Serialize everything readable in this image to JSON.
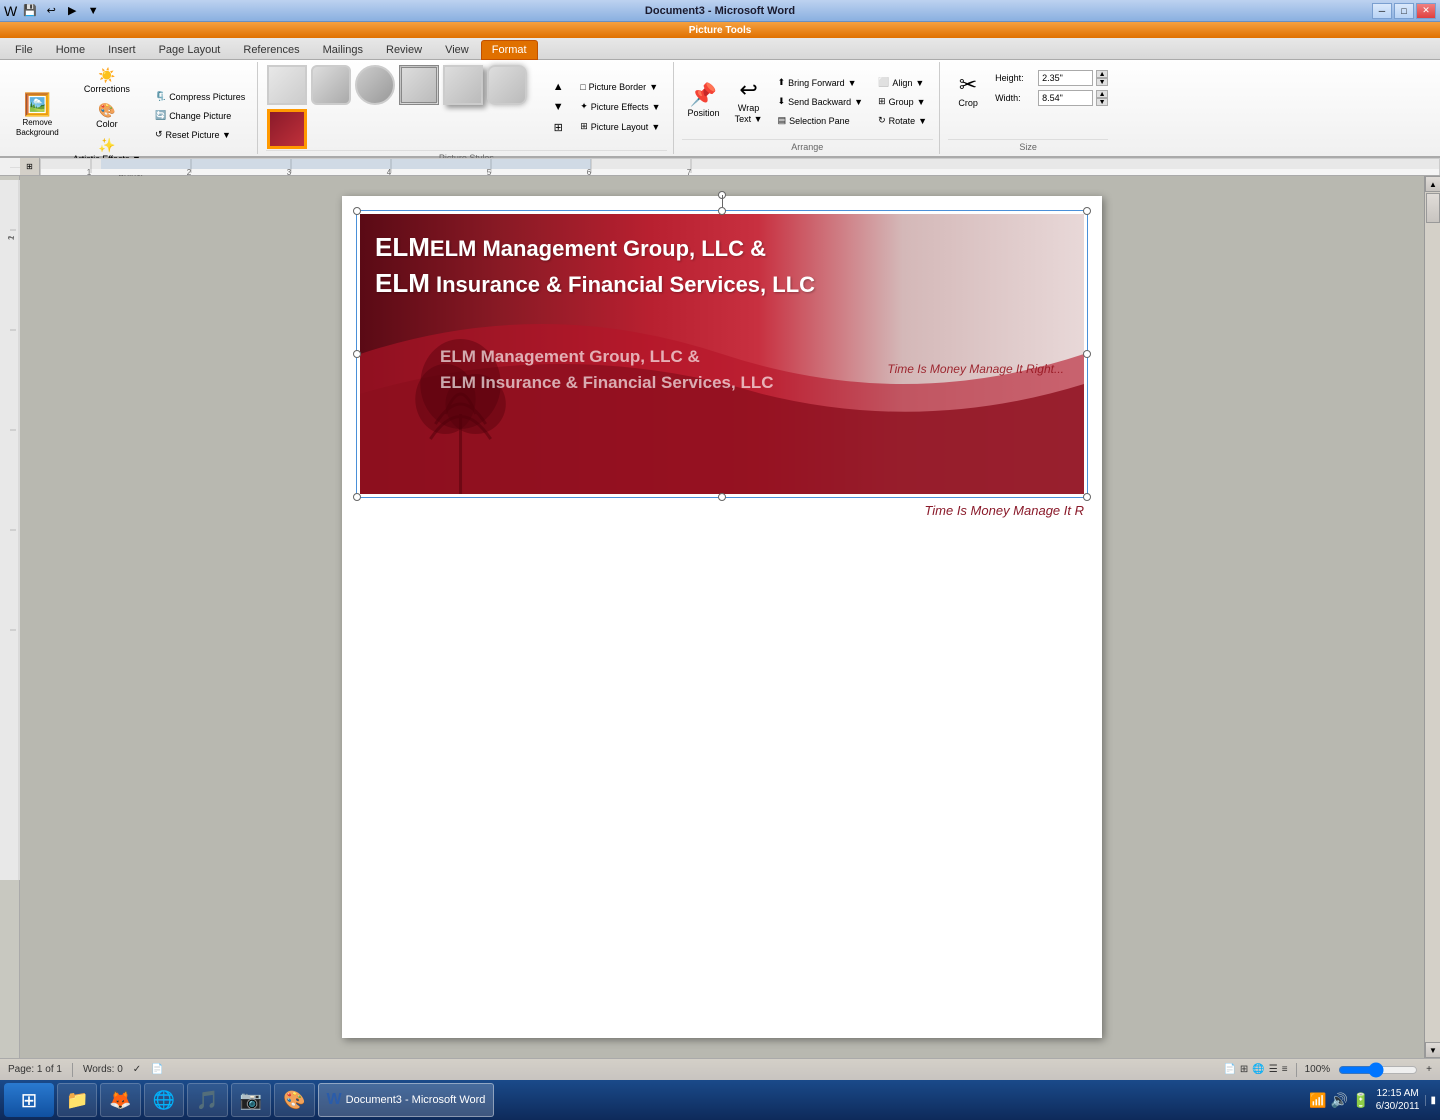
{
  "titlebar": {
    "title": "Document3 - Microsoft Word",
    "quick_access": [
      "💾",
      "↩",
      "▶",
      "▼"
    ]
  },
  "picture_tools_banner": "Picture Tools",
  "tabs": {
    "items": [
      "File",
      "Home",
      "Insert",
      "Page Layout",
      "References",
      "Mailings",
      "Review",
      "View",
      "Format"
    ],
    "active": "Format"
  },
  "ribbon": {
    "groups": {
      "adjust": {
        "label": "Adjust",
        "remove_bg": "Remove\nBackground",
        "corrections": "Corrections",
        "color": "Color",
        "artistic_effects": "Artistic\nEffects",
        "compress": "Compress Pictures",
        "change": "Change Picture",
        "reset": "Reset Picture"
      },
      "picture_styles": {
        "label": "Picture Styles",
        "border": "Picture Border",
        "effects": "Picture Effects",
        "layout": "Picture Layout"
      },
      "arrange": {
        "label": "Arrange",
        "position": "Position",
        "wrap_text": "Wrap\nText",
        "bring_forward": "Bring Forward",
        "send_backward": "Send Backward",
        "selection_pane": "Selection Pane",
        "align": "Align",
        "group": "Group",
        "rotate": "Rotate"
      },
      "size": {
        "label": "Size",
        "crop": "Crop",
        "height_label": "Height:",
        "height_value": "2.35\"",
        "width_label": "Width:",
        "width_value": "8.54\""
      }
    }
  },
  "document": {
    "header": {
      "company_line1": "ELM Management Group, LLC &",
      "company_line2": "ELM Insurance & Financial Services, LLC",
      "company_line1_ghost": "ELM Management Group, LLC &",
      "company_line2_ghost": "ELM Insurance & Financial Services, LLC",
      "tagline": "Time Is Money Manage It Right...",
      "tagline2": "Time Is Money Manage It R"
    }
  },
  "status_bar": {
    "page": "Page: 1 of 1",
    "words": "Words: 0",
    "zoom": "100%"
  },
  "taskbar": {
    "start_icon": "⊞",
    "apps": [
      {
        "icon": "📁",
        "label": ""
      },
      {
        "icon": "🦊",
        "label": ""
      },
      {
        "icon": "🌐",
        "label": ""
      },
      {
        "icon": "🎵",
        "label": ""
      },
      {
        "icon": "📷",
        "label": ""
      },
      {
        "icon": "🎨",
        "label": ""
      },
      {
        "icon": "W",
        "label": "Document3 - Microsoft Word",
        "active": true
      }
    ],
    "clock": {
      "time": "12:15 AM",
      "date": "6/30/2011"
    }
  }
}
